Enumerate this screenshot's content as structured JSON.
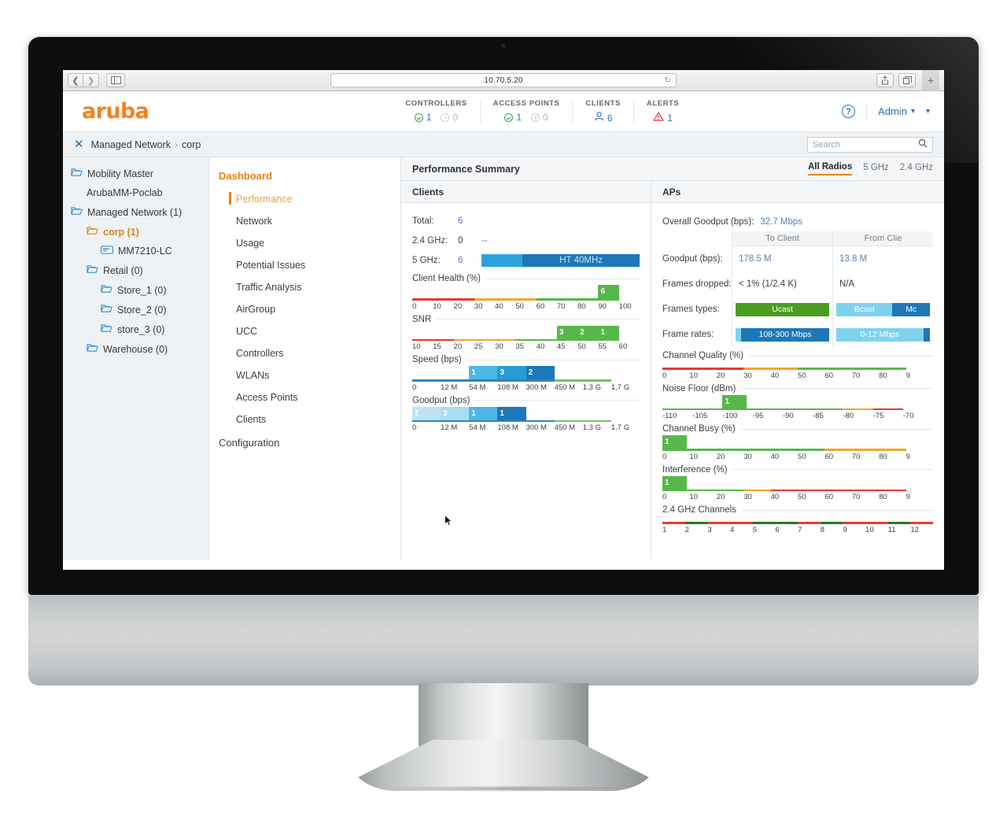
{
  "browser": {
    "url": "10.70.5.20",
    "back_icon": "chevron-left-icon",
    "forward_icon": "chevron-right-icon",
    "sidebar_icon": "sidebar-toggle-icon",
    "reload_icon": "reload-icon",
    "share_icon": "share-icon",
    "tabs_icon": "tab-overview-icon",
    "new_tab_label": "+"
  },
  "header": {
    "logo": "aruba",
    "stats": [
      {
        "title": "CONTROLLERS",
        "up": "1",
        "down": "0"
      },
      {
        "title": "ACCESS POINTS",
        "up": "1",
        "down": "0"
      },
      {
        "title": "CLIENTS",
        "up": "6",
        "down": null
      },
      {
        "title": "ALERTS",
        "up": "1",
        "down": null
      }
    ],
    "help_label": "?",
    "admin_label": "Admin"
  },
  "breadcrumb": {
    "close_label": "✕",
    "root": "Managed Network",
    "separator": "›",
    "current": "corp"
  },
  "search": {
    "placeholder": "Search",
    "value": ""
  },
  "tree": {
    "items": [
      {
        "label": "Mobility Master",
        "level": 1,
        "icon": "folder-icon",
        "active": false
      },
      {
        "label": "ArubaMM-Poclab",
        "level": 2,
        "icon": null,
        "active": false
      },
      {
        "label": "Managed Network (1)",
        "level": 1,
        "icon": "folder-icon",
        "active": false
      },
      {
        "label": "corp (1)",
        "level": 2,
        "icon": "folder-icon",
        "active": true
      },
      {
        "label": "MM7210-LC",
        "level": 3,
        "icon": "device-icon",
        "active": false
      },
      {
        "label": "Retail (0)",
        "level": 2,
        "icon": "folder-icon",
        "active": false
      },
      {
        "label": "Store_1 (0)",
        "level": 3,
        "icon": "folder-icon",
        "active": false
      },
      {
        "label": "Store_2 (0)",
        "level": 3,
        "icon": "folder-icon",
        "active": false
      },
      {
        "label": "store_3 (0)",
        "level": 3,
        "icon": "folder-icon",
        "active": false
      },
      {
        "label": "Warehouse (0)",
        "level": 2,
        "icon": "folder-icon",
        "active": false
      }
    ]
  },
  "nav": {
    "header": "Dashboard",
    "items": [
      {
        "label": "Performance",
        "selected": true
      },
      {
        "label": "Network",
        "selected": false
      },
      {
        "label": "Usage",
        "selected": false
      },
      {
        "label": "Potential Issues",
        "selected": false
      },
      {
        "label": "Traffic Analysis",
        "selected": false
      },
      {
        "label": "AirGroup",
        "selected": false
      },
      {
        "label": "UCC",
        "selected": false
      },
      {
        "label": "Controllers",
        "selected": false
      },
      {
        "label": "WLANs",
        "selected": false
      },
      {
        "label": "Access Points",
        "selected": false
      },
      {
        "label": "Clients",
        "selected": false
      }
    ],
    "footer": "Configuration"
  },
  "panel": {
    "title": "Performance Summary",
    "radio_tabs": [
      {
        "label": "All Radios",
        "active": true
      },
      {
        "label": "5 GHz",
        "active": false
      },
      {
        "label": "2.4 GHz",
        "active": false
      }
    ]
  },
  "clients": {
    "title": "Clients",
    "total_label": "Total:",
    "total_value": "6",
    "band24_label": "2.4 GHz:",
    "band24_value": "0",
    "band24_extra": "--",
    "band5_label": "5 GHz:",
    "band5_value": "6",
    "band5_bar_label": "HT 40MHz"
  },
  "aps": {
    "title": "APs",
    "overall_goodput_label": "Overall Goodput (bps):",
    "overall_goodput_value": "32.7 Mbps",
    "col_headers": [
      "To Client",
      "From Clie"
    ],
    "rows": [
      {
        "label": "Goodput (bps):",
        "to_client": "178.5 M",
        "from_client": "13.8 M"
      },
      {
        "label": "Frames dropped:",
        "to_client": "< 1% (1/2.4 K)",
        "from_client": "N/A"
      }
    ],
    "frames_types_label": "Frames types:",
    "frame_rates_label": "Frame rates:",
    "frames_types": {
      "to_client": [
        {
          "label": "Ucast",
          "color": "#4a9d1f",
          "width": 100
        }
      ],
      "from_client": [
        {
          "label": "Bcast",
          "color": "#7fd2ee",
          "width": 60
        },
        {
          "label": "Mc",
          "color": "#1c78b8",
          "width": 40
        }
      ]
    },
    "frame_rates": {
      "to_client": [
        {
          "label": "",
          "color": "#7fd2ee",
          "width": 6
        },
        {
          "label": "108-300 Mbps",
          "color": "#1c78b8",
          "width": 94
        }
      ],
      "from_client": [
        {
          "label": "0-12 Mbps",
          "color": "#7fd2ee",
          "width": 93
        },
        {
          "label": "",
          "color": "#1c78b8",
          "width": 7
        }
      ]
    }
  },
  "chart_data": [
    {
      "type": "bar",
      "name": "client-health",
      "title": "Client Health (%)",
      "panel": "clients",
      "xlabel": "",
      "ticks": [
        "0",
        "10",
        "20",
        "30",
        "40",
        "50",
        "60",
        "70",
        "80",
        "90",
        "100"
      ],
      "xlim": [
        0,
        100
      ],
      "bars": [
        {
          "label": "6",
          "start": 90,
          "end": 100,
          "color": "#56b848"
        }
      ],
      "zones": [
        {
          "from": 0,
          "to": 30,
          "color": "#e8382f"
        },
        {
          "from": 30,
          "to": 60,
          "color": "#f5a623"
        },
        {
          "from": 60,
          "to": 100,
          "color": "#56b848"
        }
      ]
    },
    {
      "type": "bar",
      "name": "snr",
      "title": "SNR",
      "panel": "clients",
      "ticks": [
        "10",
        "15",
        "20",
        "25",
        "30",
        "35",
        "40",
        "45",
        "50",
        "55",
        "60"
      ],
      "xlim": [
        10,
        60
      ],
      "bars": [
        {
          "label": "3",
          "start": 45,
          "end": 50,
          "color": "#56b848"
        },
        {
          "label": "2",
          "start": 50,
          "end": 55,
          "color": "#56b848"
        },
        {
          "label": "1",
          "start": 55,
          "end": 60,
          "color": "#56b848"
        }
      ],
      "zones": [
        {
          "from": 10,
          "to": 20,
          "color": "#e8382f"
        },
        {
          "from": 20,
          "to": 35,
          "color": "#f5a623"
        },
        {
          "from": 35,
          "to": 60,
          "color": "#56b848"
        }
      ]
    },
    {
      "type": "bar",
      "name": "speed-bps",
      "title": "Speed (bps)",
      "panel": "clients",
      "ticks": [
        "0",
        "12 M",
        "54 M",
        "108 M",
        "300 M",
        "450 M",
        "1.3 G",
        "1.7 G"
      ],
      "bars": [
        {
          "label": "1",
          "start_idx": 2,
          "end_idx": 3,
          "color": "#4cb7e5"
        },
        {
          "label": "3",
          "start_idx": 3,
          "end_idx": 4,
          "color": "#2a9bd4"
        },
        {
          "label": "2",
          "start_idx": 4,
          "end_idx": 5,
          "color": "#1c78b8"
        }
      ],
      "zones": [
        {
          "from_idx": 0,
          "to_idx": 5,
          "color": "#2d84c4"
        },
        {
          "from_idx": 5,
          "to_idx": 7,
          "color": "#72c463"
        }
      ]
    },
    {
      "type": "bar",
      "name": "goodput-bps",
      "title": "Goodput (bps)",
      "panel": "clients",
      "ticks": [
        "0",
        "12 M",
        "54 M",
        "108 M",
        "300 M",
        "450 M",
        "1.3 G",
        "1.7 G"
      ],
      "bars": [
        {
          "label": "1",
          "start_idx": 0,
          "end_idx": 1,
          "color": "#bce5f5"
        },
        {
          "label": "3",
          "start_idx": 1,
          "end_idx": 2,
          "color": "#a9ddf2"
        },
        {
          "label": "1",
          "start_idx": 2,
          "end_idx": 3,
          "color": "#4cb7e5"
        },
        {
          "label": "1",
          "start_idx": 3,
          "end_idx": 4,
          "color": "#1c78b8"
        }
      ],
      "zones": [
        {
          "from_idx": 0,
          "to_idx": 5,
          "color": "#2d84c4"
        },
        {
          "from_idx": 5,
          "to_idx": 7,
          "color": "#72c463"
        }
      ]
    },
    {
      "type": "bar",
      "name": "channel-quality",
      "title": "Channel Quality (%)",
      "panel": "aps",
      "ticks": [
        "0",
        "10",
        "20",
        "30",
        "40",
        "50",
        "60",
        "70",
        "80",
        "9"
      ],
      "bars": [],
      "zones": [
        {
          "from": 0,
          "to": 30,
          "color": "#e8382f"
        },
        {
          "from": 30,
          "to": 50,
          "color": "#f5a623"
        },
        {
          "from": 50,
          "to": 90,
          "color": "#56b848"
        }
      ],
      "xlim": [
        0,
        90
      ]
    },
    {
      "type": "bar",
      "name": "noise-floor",
      "title": "Noise Floor (dBm)",
      "panel": "aps",
      "ticks": [
        "-110",
        "-105",
        "-100",
        "-95",
        "-90",
        "-85",
        "-80",
        "-75",
        "-70"
      ],
      "xlim": [
        -110,
        -70
      ],
      "bars": [
        {
          "label": "1",
          "start": -100,
          "end": -96,
          "color": "#56b848"
        }
      ],
      "zones": [
        {
          "from": -110,
          "to": -80,
          "color": "#56b848"
        },
        {
          "from": -80,
          "to": -75,
          "color": "#f5a623"
        },
        {
          "from": -75,
          "to": -70,
          "color": "#e8382f"
        }
      ]
    },
    {
      "type": "bar",
      "name": "channel-busy",
      "title": "Channel Busy (%)",
      "panel": "aps",
      "ticks": [
        "0",
        "10",
        "20",
        "30",
        "40",
        "50",
        "60",
        "70",
        "80",
        "9"
      ],
      "xlim": [
        0,
        90
      ],
      "bars": [
        {
          "label": "1",
          "start": 0,
          "end": 9,
          "color": "#56b848"
        }
      ],
      "zones": [
        {
          "from": 0,
          "to": 60,
          "color": "#56b848"
        },
        {
          "from": 60,
          "to": 90,
          "color": "#f5a623"
        }
      ]
    },
    {
      "type": "bar",
      "name": "interference",
      "title": "Interference (%)",
      "panel": "aps",
      "ticks": [
        "0",
        "10",
        "20",
        "30",
        "40",
        "50",
        "60",
        "70",
        "80",
        "9"
      ],
      "xlim": [
        0,
        90
      ],
      "bars": [
        {
          "label": "1",
          "start": 0,
          "end": 9,
          "color": "#56b848"
        }
      ],
      "zones": [
        {
          "from": 0,
          "to": 30,
          "color": "#56b848"
        },
        {
          "from": 30,
          "to": 40,
          "color": "#f5a623"
        },
        {
          "from": 40,
          "to": 90,
          "color": "#e8382f"
        }
      ]
    },
    {
      "type": "bar",
      "name": "channels-24ghz",
      "title": "2.4 GHz Channels",
      "panel": "aps",
      "ticks": [
        "1",
        "2",
        "3",
        "4",
        "5",
        "6",
        "7",
        "8",
        "9",
        "10",
        "11",
        "12"
      ],
      "bars": [],
      "zones": [
        {
          "from_idx": 0,
          "to_idx": 1,
          "color": "#e8382f"
        },
        {
          "from_idx": 1,
          "to_idx": 2,
          "color": "#1f7a1f"
        },
        {
          "from_idx": 2,
          "to_idx": 4,
          "color": "#e8382f"
        },
        {
          "from_idx": 4,
          "to_idx": 6,
          "color": "#1f7a1f"
        },
        {
          "from_idx": 6,
          "to_idx": 7,
          "color": "#e8382f"
        },
        {
          "from_idx": 7,
          "to_idx": 8,
          "color": "#1f7a1f"
        },
        {
          "from_idx": 8,
          "to_idx": 10,
          "color": "#e8382f"
        },
        {
          "from_idx": 10,
          "to_idx": 11,
          "color": "#1f7a1f"
        },
        {
          "from_idx": 11,
          "to_idx": 12,
          "color": "#e8382f"
        }
      ]
    }
  ]
}
